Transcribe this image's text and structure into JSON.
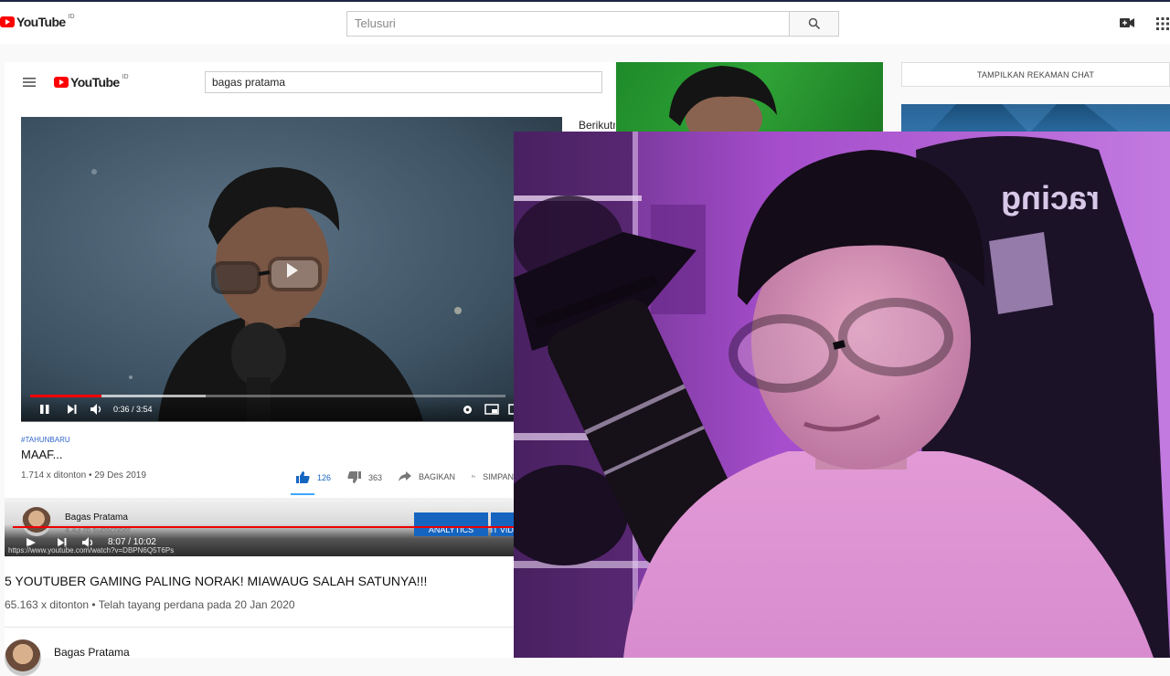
{
  "outer_header": {
    "logo_text": "YouTube",
    "logo_region": "ID",
    "search_placeholder": "Telusuri",
    "icons": [
      "menu-icon",
      "search-icon",
      "video-camera-icon",
      "apps-grid-icon"
    ]
  },
  "inner_header": {
    "logo_text": "YouTube",
    "logo_region": "ID",
    "search_value": "bagas pratama"
  },
  "player1": {
    "time": "0:36 / 3:54",
    "progress_fraction": 0.15,
    "buffered_fraction": 0.37
  },
  "video1": {
    "hashtag": "#TAHUNBARU",
    "title": "MAAF...",
    "stats": "1.714 x ditonton • 29 Des 2019",
    "likes": "126",
    "dislikes": "363",
    "share_label": "BAGIKAN",
    "save_label": "SIMPAN"
  },
  "channel1": {
    "name": "Bagas Pratama",
    "subscribers": "4.43 rb subscriber",
    "analytics_label": "ANALYTICS",
    "edit_label": "EDIT VIDEO"
  },
  "player2": {
    "time": "8:07 / 10:02",
    "hover_url": "https://www.youtube.com/watch?v=DBPN6Q5T6Ps"
  },
  "video2": {
    "title": "5 YOUTUBER GAMING PALING NORAK! MIAWAUG SALAH SATUNYA!!!",
    "stats": "65.163 x ditonton • Telah tayang perdana pada 20 Jan 2020",
    "channel_name": "Bagas Pratama"
  },
  "sidebar": {
    "up_next_label": "Berikutnya"
  },
  "chat": {
    "replay_label": "TAMPILKAN REKAMAN CHAT"
  },
  "webcam": {
    "chair_text": "racing"
  },
  "colors": {
    "youtube_red": "#ff0000",
    "button_blue": "#1565c0",
    "link_blue": "#3366cc",
    "webcam_purple": "#8a3fb0"
  }
}
